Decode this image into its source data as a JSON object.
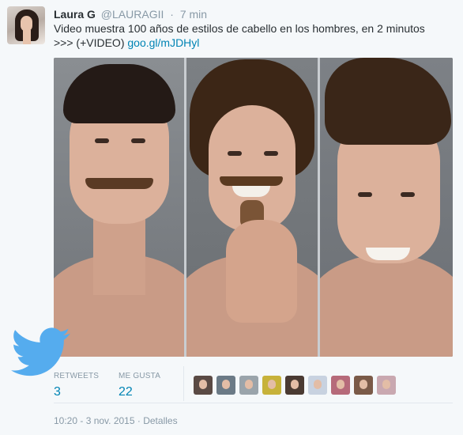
{
  "tweet": {
    "author_name": "Laura G",
    "author_handle": "@LAURAGII",
    "separator": "·",
    "time_ago": "7 min",
    "text_line1": "Video muestra 100 años de estilos de cabello en los hombres, en 2 minutos",
    "text_prefix": ">>> (+VIDEO) ",
    "link": "goo.gl/mJDHyl"
  },
  "stats": {
    "retweets_label": "RETWEETS",
    "retweets_count": "3",
    "likes_label": "ME GUSTA",
    "likes_count": "22"
  },
  "likers": [
    {
      "color": "#5a4a44"
    },
    {
      "color": "#6b7a86"
    },
    {
      "color": "#9aa4ab"
    },
    {
      "color": "#c7b23a"
    },
    {
      "color": "#4a3a32"
    },
    {
      "color": "#c8d2e0"
    },
    {
      "color": "#b66a7a"
    },
    {
      "color": "#7a5a48"
    },
    {
      "color": "#c9a8b0"
    }
  ],
  "footer": {
    "timestamp": "10:20 - 3 nov. 2015",
    "separator": "·",
    "details_label": "Detalles"
  },
  "icons": {
    "brand": "twitter-bird-icon"
  },
  "colors": {
    "link": "#0084b4",
    "muted": "#8899a6",
    "background": "#f5f8fa",
    "brand": "#55acee"
  }
}
